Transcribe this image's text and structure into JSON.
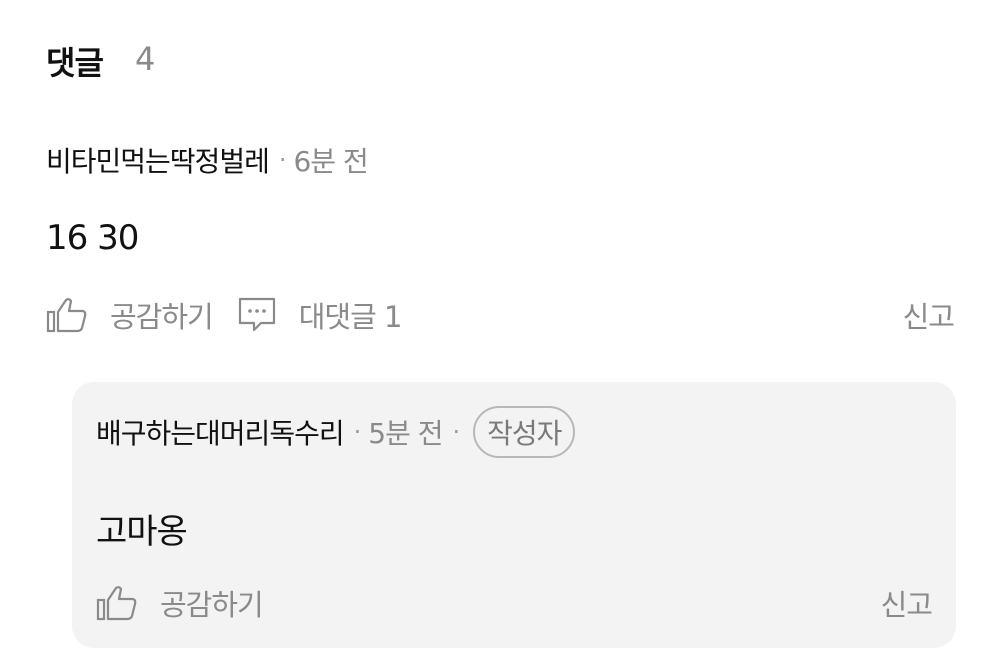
{
  "header": {
    "title": "댓글",
    "count": "4"
  },
  "comment": {
    "author": "비타민먹는딱정벌레",
    "separator": "·",
    "time": "6분 전",
    "text": "16 30",
    "like_label": "공감하기",
    "reply_label": "대댓글 1",
    "report_label": "신고"
  },
  "reply": {
    "author": "배구하는대머리독수리",
    "separator": "·",
    "time": "5분 전",
    "badge": "작성자",
    "text": "고마옹",
    "like_label": "공감하기",
    "report_label": "신고"
  },
  "icons": {
    "like": "thumbs-up-icon",
    "reply": "speech-bubble-icon"
  },
  "colors": {
    "text": "#111111",
    "muted": "#8a8a8a",
    "reply_bg": "#f3f3f3",
    "badge_border": "#b8b8b8"
  }
}
